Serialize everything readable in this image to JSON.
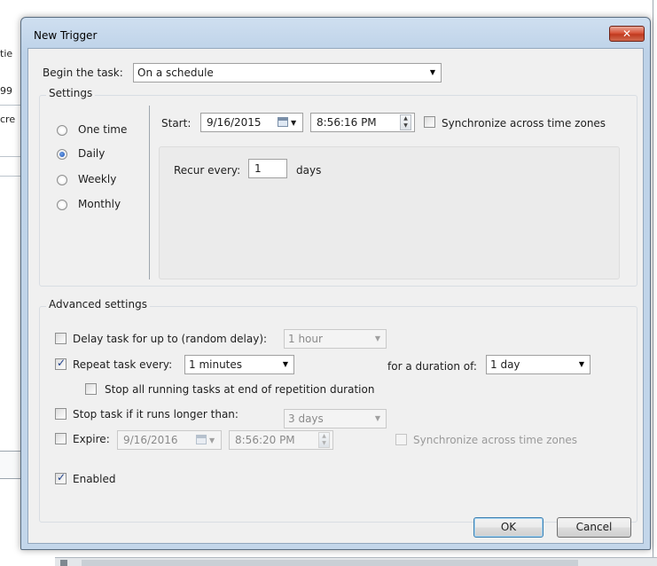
{
  "background": {
    "fragments": [
      "tie",
      "99",
      "cre"
    ]
  },
  "window": {
    "title": "New Trigger",
    "close_glyph": "✕"
  },
  "begin": {
    "label": "Begin the task:",
    "value": "On a schedule"
  },
  "settings": {
    "legend": "Settings",
    "options": [
      {
        "label": "One time",
        "selected": false
      },
      {
        "label": "Daily",
        "selected": true
      },
      {
        "label": "Weekly",
        "selected": false
      },
      {
        "label": "Monthly",
        "selected": false
      }
    ],
    "start_label": "Start:",
    "start_date": "9/16/2015",
    "start_time": "8:56:16 PM",
    "sync_label": "Synchronize across time zones",
    "sync_checked": false,
    "recur_label": "Recur every:",
    "recur_value": "1",
    "recur_unit": "days"
  },
  "advanced": {
    "legend": "Advanced settings",
    "delay_label": "Delay task for up to (random delay):",
    "delay_value": "1 hour",
    "repeat_label": "Repeat task every:",
    "repeat_value": "1 minutes",
    "duration_label": "for a duration of:",
    "duration_value": "1 day",
    "stop_all_label": "Stop all running tasks at end of repetition duration",
    "stop_if_label": "Stop task if it runs longer than:",
    "stop_if_value": "3 days",
    "expire_label": "Expire:",
    "expire_date": "9/16/2016",
    "expire_time": "8:56:20 PM",
    "expire_sync_label": "Synchronize across time zones",
    "enabled_label": "Enabled"
  },
  "buttons": {
    "ok": "OK",
    "cancel": "Cancel"
  },
  "colors": {
    "frame": "#c3d6ea",
    "client": "#f0f0f0",
    "close": "#c9452a"
  }
}
